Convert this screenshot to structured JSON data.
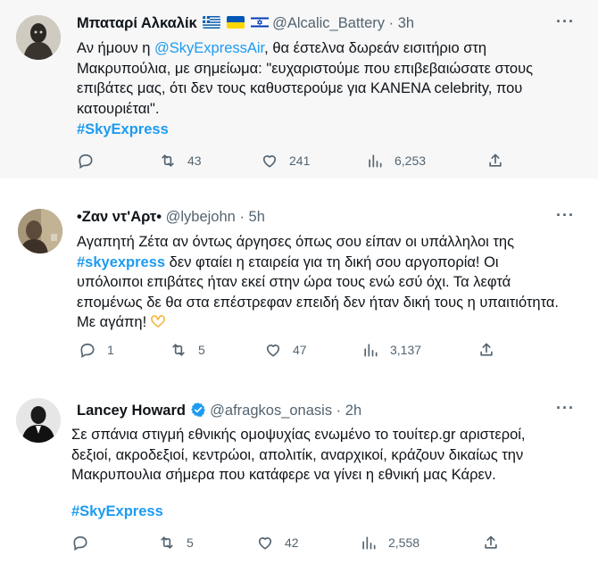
{
  "tweets": [
    {
      "name": "Μπαταρί Αλκαλίκ",
      "handle": "@Alcalic_Battery",
      "time": "3h",
      "more": "···",
      "text_lines": [
        [
          "Αν ήμουν η ",
          "@SkyExpressAir",
          ", θα έστελνα δωρεάν εισιτήριο στη"
        ],
        "Μακρυπούλια, με σημείωμα: \"ευχαριστούμε που επιβεβαιώσατε στους",
        "επιβάτες μας, ότι δεν τους καθυστερούμε για ΚΑΝΕΝΑ celebrity, που",
        "κατουριέται\"."
      ],
      "hashtag": "#SkyExpress",
      "stats": {
        "replies": "",
        "retweets": "43",
        "likes": "241",
        "views": "6,253"
      }
    },
    {
      "name": "•Ζαν ντ'Αρτ•",
      "handle": "@lybejohn",
      "time": "5h",
      "more": "···",
      "text_lines": [
        "Αγαπητή Ζέτα αν όντως άργησες όπως σου είπαν οι υπάλληλοι της",
        [
          "#skyexpress",
          " δεν φταίει η εταιρεία για τη δική σου αργοπορία! Οι"
        ],
        "υπόλοιποι επιβάτες ήταν εκεί στην ώρα τους ενώ εσύ όχι. Τα λεφτά",
        "επομένως δε θα στα επέστρεφαν επειδή δεν ήταν δική τους η υπαιτιότητα.",
        "Με αγάπη!"
      ],
      "stats": {
        "replies": "1",
        "retweets": "5",
        "likes": "47",
        "views": "3,137"
      }
    },
    {
      "name": "Lancey Howard",
      "handle": "@afragkos_onasis",
      "time": "2h",
      "more": "···",
      "text_lines": [
        "Σε σπάνια στιγμή εθνικής ομοψυχίας ενωμένο το τουίτερ.gr αριστεροί,",
        "δεξιοί, ακροδεξιοί, κεντρώοι, απολιτίκ, αναρχικοί, κράζουν δικαίως την",
        "Μακρυπουλια σήμερα που κατάφερε να γίνει η εθνική μας Κάρεν."
      ],
      "hashtag": "#SkyExpress",
      "stats": {
        "replies": "",
        "retweets": "5",
        "likes": "42",
        "views": "2,558"
      }
    }
  ],
  "colors": {
    "link": "#1d9bf0",
    "muted": "#536471",
    "text": "#0f1419",
    "verified": "#1d9bf0"
  }
}
